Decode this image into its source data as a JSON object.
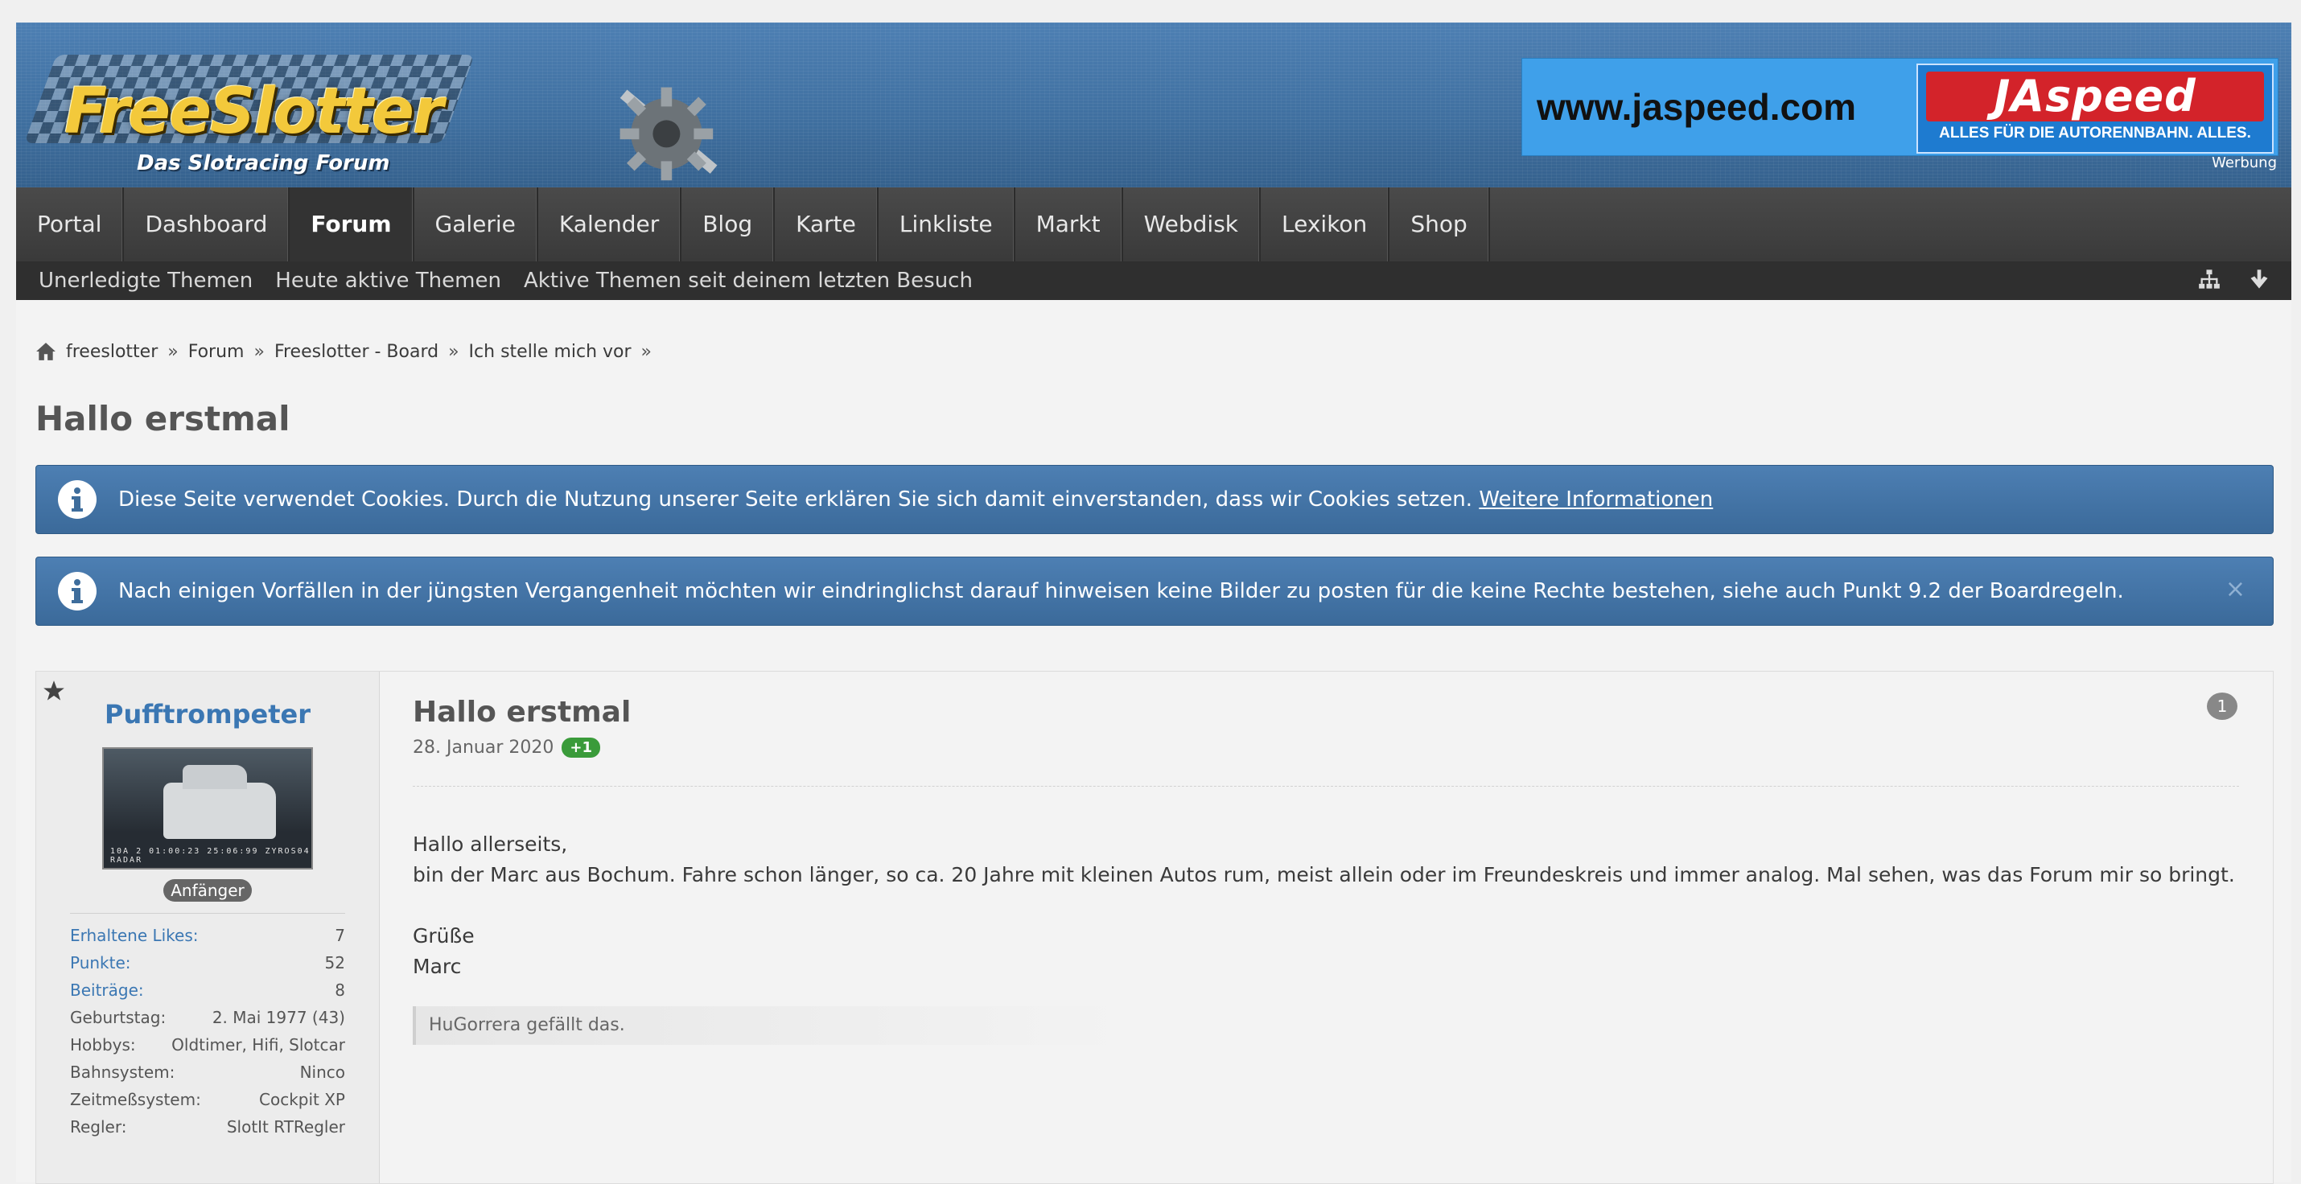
{
  "header": {
    "logo_text": "FreeSlotter",
    "logo_sub": "Das Slotracing Forum",
    "ad": {
      "url": "www.jaspeed.com",
      "brand": "JAspeed",
      "tagline": "ALLES FÜR DIE AUTORENNBAHN. ALLES.",
      "note": "Werbung"
    }
  },
  "nav": {
    "items": [
      {
        "label": "Portal"
      },
      {
        "label": "Dashboard"
      },
      {
        "label": "Forum"
      },
      {
        "label": "Galerie"
      },
      {
        "label": "Kalender"
      },
      {
        "label": "Blog"
      },
      {
        "label": "Karte"
      },
      {
        "label": "Linkliste"
      },
      {
        "label": "Markt"
      },
      {
        "label": "Webdisk"
      },
      {
        "label": "Lexikon"
      },
      {
        "label": "Shop"
      }
    ],
    "active": "Forum"
  },
  "subnav": {
    "items": [
      {
        "label": "Unerledigte Themen"
      },
      {
        "label": "Heute aktive Themen"
      },
      {
        "label": "Aktive Themen seit deinem letzten Besuch"
      }
    ]
  },
  "breadcrumb": {
    "items": [
      {
        "label": "freeslotter"
      },
      {
        "label": "Forum"
      },
      {
        "label": "Freeslotter - Board"
      },
      {
        "label": "Ich stelle mich vor"
      }
    ],
    "separator": "»"
  },
  "page_title": "Hallo erstmal",
  "notices": {
    "cookie_text": "Diese Seite verwendet Cookies. Durch die Nutzung unserer Seite erklären Sie sich damit einverstanden, dass wir Cookies setzen.",
    "cookie_link": "Weitere Informationen",
    "rules_text": "Nach einigen Vorfällen in der jüngsten Vergangenheit möchten wir eindringlichst darauf hinweisen keine Bilder zu posten für die keine Rechte bestehen, siehe auch Punkt 9.2 der Boardregeln.",
    "close_symbol": "×"
  },
  "post": {
    "author": "Pufftrompeter",
    "avatar_stamp": "10A 2 01:00:23 25:06:99 ZYROS04 RADAR",
    "rank": "Anfänger",
    "stats": [
      {
        "label": "Erhaltene Likes:",
        "value": "7",
        "link": true
      },
      {
        "label": "Punkte:",
        "value": "52",
        "link": true
      },
      {
        "label": "Beiträge:",
        "value": "8",
        "link": true
      },
      {
        "label": "Geburtstag:",
        "value": "2. Mai 1977 (43)",
        "link": false
      },
      {
        "label": "Hobbys:",
        "value": "Oldtimer, Hifi, Slotcar",
        "link": false
      },
      {
        "label": "Bahnsystem:",
        "value": "Ninco",
        "link": false
      },
      {
        "label": "Zeitmeßsystem:",
        "value": "Cockpit XP",
        "link": false
      },
      {
        "label": "Regler:",
        "value": "SlotIt RTRegler",
        "link": false
      }
    ],
    "title": "Hallo erstmal",
    "date": "28. Januar 2020",
    "like_badge": "+1",
    "number": "1",
    "message": {
      "line1": "Hallo allerseits,",
      "line2": "bin der Marc aus Bochum. Fahre schon länger, so ca. 20 Jahre mit kleinen Autos rum, meist allein oder im Freundeskreis und immer analog. Mal sehen, was das Forum mir so bringt.",
      "line3": "Grüße",
      "line4": "Marc"
    },
    "likes_text": "HuGorrera gefällt das."
  },
  "colors": {
    "header_blue": "#4d7fb3",
    "nav_dark": "#3a3a3a",
    "link_blue": "#3b77b3",
    "like_green": "#3a9b3a"
  },
  "icons": {
    "home": "home-icon",
    "sitemap": "sitemap-icon",
    "scroll_down": "arrow-down-icon",
    "info": "info-icon",
    "star": "star-icon",
    "close": "close-icon"
  }
}
